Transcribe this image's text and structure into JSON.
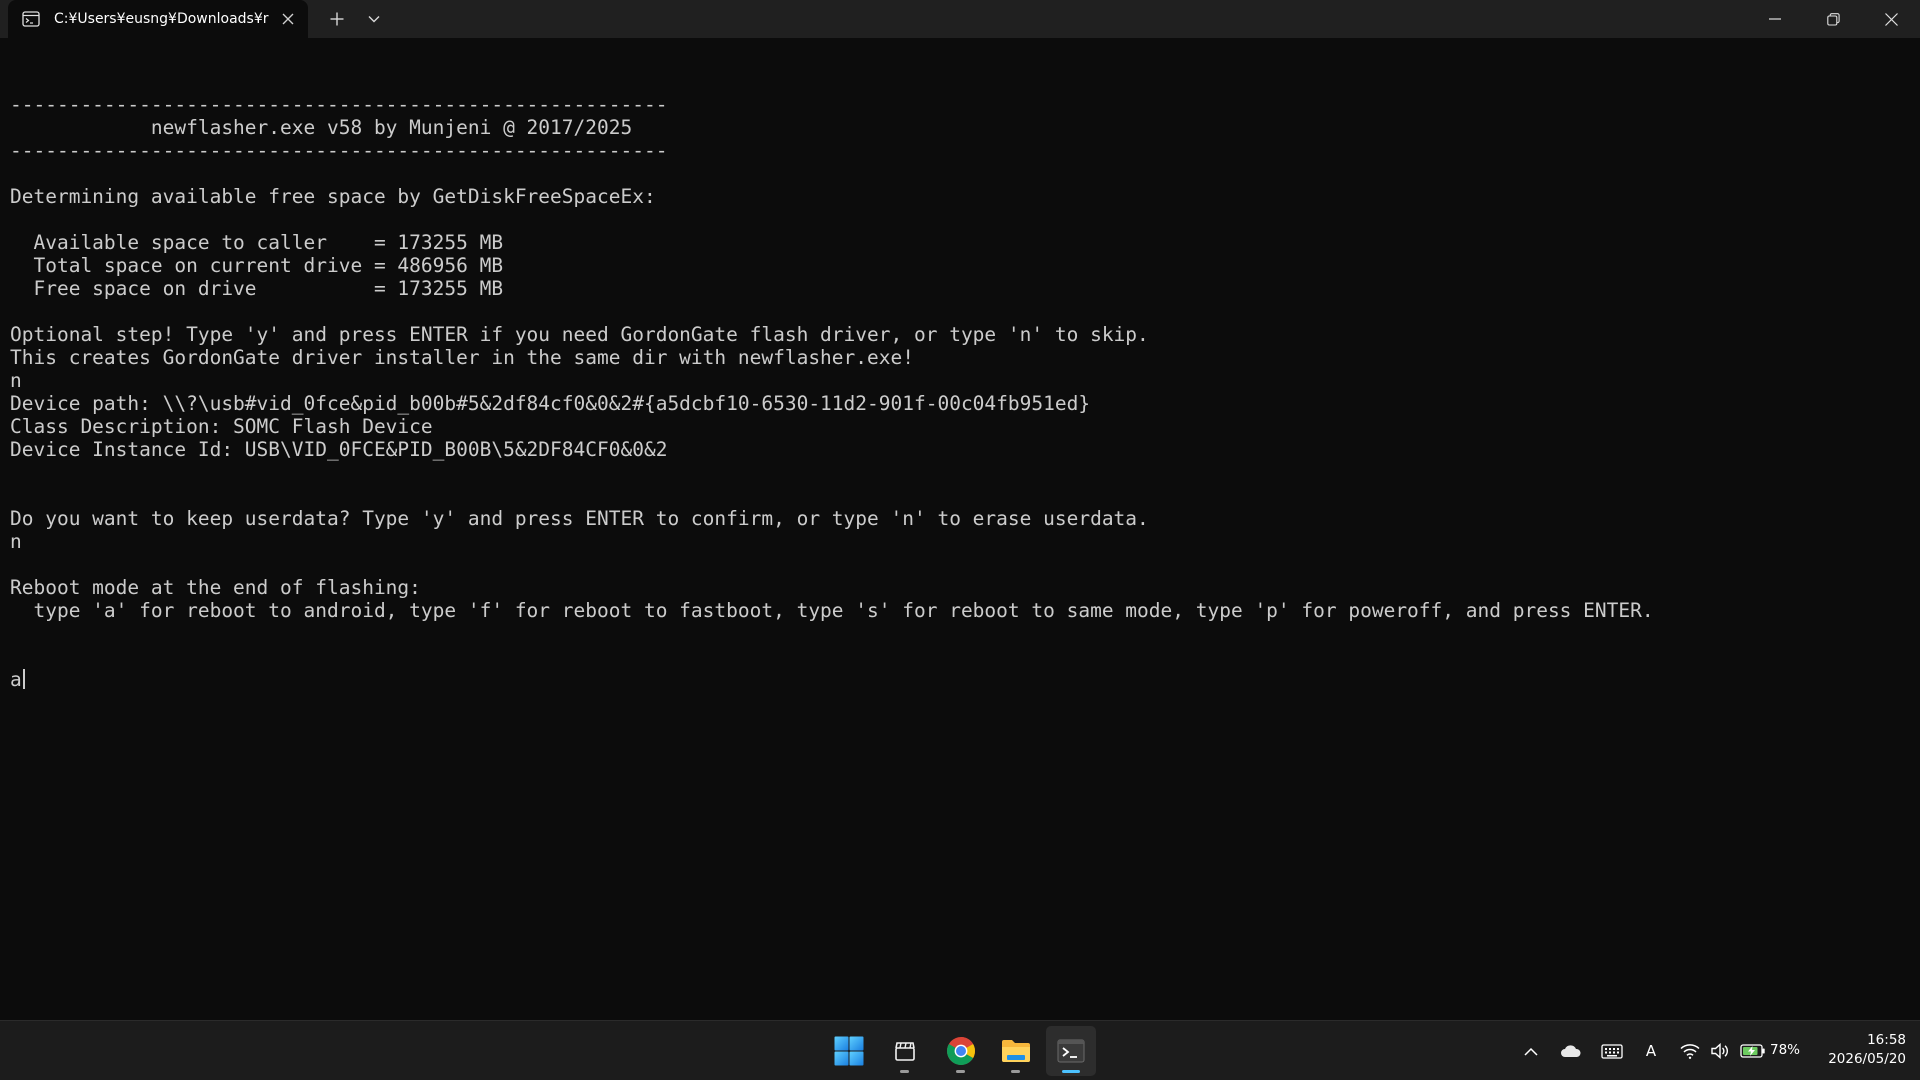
{
  "window": {
    "tab": {
      "title": "C:¥Users¥eusng¥Downloads¥r",
      "icon": "terminal-tab-icon"
    },
    "controls": {
      "new_tab_icon": "plus-icon",
      "dropdown_icon": "chevron-down-icon",
      "minimize_icon": "minimize-icon",
      "maximize_icon": "restore-icon",
      "close_icon": "close-icon"
    }
  },
  "terminal": {
    "lines": [
      "--------------------------------------------------------",
      "            newflasher.exe v58 by Munjeni @ 2017/2025",
      "--------------------------------------------------------",
      "",
      "Determining available free space by GetDiskFreeSpaceEx:",
      "",
      "  Available space to caller    = 173255 MB",
      "  Total space on current drive = 486956 MB",
      "  Free space on drive          = 173255 MB",
      "",
      "Optional step! Type 'y' and press ENTER if you need GordonGate flash driver, or type 'n' to skip.",
      "This creates GordonGate driver installer in the same dir with newflasher.exe!",
      "n",
      "Device path: \\\\?\\usb#vid_0fce&pid_b00b#5&2df84cf0&0&2#{a5dcbf10-6530-11d2-901f-00c04fb951ed}",
      "Class Description: SOMC Flash Device",
      "Device Instance Id: USB\\VID_0FCE&PID_B00B\\5&2DF84CF0&0&2",
      "",
      "",
      "Do you want to keep userdata? Type 'y' and press ENTER to confirm, or type 'n' to erase userdata.",
      "n",
      "",
      "Reboot mode at the end of flashing:",
      "  type 'a' for reboot to android, type 'f' for reboot to fastboot, type 's' for reboot to same mode, type 'p' for poweroff, and press ENTER."
    ],
    "input": "a",
    "text_color": "#cccccc",
    "background": "#0c0c0c"
  },
  "taskbar": {
    "apps": [
      {
        "name": "start-button",
        "icon": "windows-logo-icon"
      },
      {
        "name": "clapperboard-app",
        "icon": "clapperboard-icon"
      },
      {
        "name": "chrome-app",
        "icon": "chrome-icon"
      },
      {
        "name": "file-explorer-app",
        "icon": "folder-icon"
      },
      {
        "name": "terminal-app",
        "icon": "terminal-icon",
        "active": true
      }
    ],
    "tray": {
      "ime_label": "A",
      "battery_percent": "78%",
      "time": "16:58",
      "date": "2026/05/20"
    },
    "accent_color": "#4cc2ff"
  }
}
